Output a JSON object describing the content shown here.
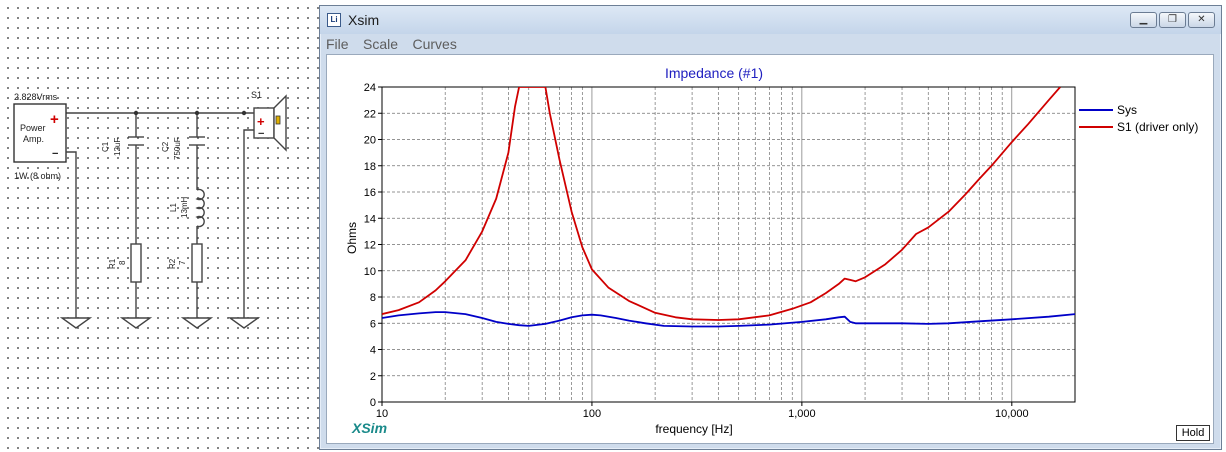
{
  "schematic": {
    "source_voltage": "2.828Vrms",
    "source_label_line1": "Power",
    "source_label_line2": "Amp.",
    "source_rating": "1W (8 ohm)",
    "plus": "+",
    "minus": "−",
    "c1_name": "C1",
    "c1_value": "12uF",
    "c2_name": "C2",
    "c2_value": "750uF",
    "l1_name": "L1",
    "l1_value": "13mH",
    "r1_name": "R1",
    "r1_value": "8",
    "r2_name": "R2",
    "r2_value": "7",
    "speaker_name": "S1"
  },
  "window": {
    "title": "Xsim",
    "icon_text": "Li",
    "menu": [
      "File",
      "Scale",
      "Curves"
    ],
    "brand": "XSim",
    "hold_label": "Hold"
  },
  "chart_data": {
    "type": "line",
    "title": "Impedance (#1)",
    "xlabel": "frequency [Hz]",
    "ylabel": "Ohms",
    "x_scale": "log",
    "xlim": [
      10,
      20000
    ],
    "ylim": [
      0,
      24
    ],
    "x_ticks": [
      10,
      100,
      1000,
      10000
    ],
    "x_tick_labels": [
      "10",
      "100",
      "1,000",
      "10,000"
    ],
    "y_ticks": [
      0,
      2,
      4,
      6,
      8,
      10,
      12,
      14,
      16,
      18,
      20,
      22,
      24
    ],
    "grid": true,
    "legend_position": "right",
    "series": [
      {
        "name": "Sys",
        "color": "#0000c8",
        "points": [
          [
            10,
            6.4
          ],
          [
            12,
            6.6
          ],
          [
            15,
            6.75
          ],
          [
            18,
            6.85
          ],
          [
            20,
            6.85
          ],
          [
            25,
            6.7
          ],
          [
            30,
            6.4
          ],
          [
            35,
            6.1
          ],
          [
            40,
            5.95
          ],
          [
            45,
            5.85
          ],
          [
            50,
            5.8
          ],
          [
            60,
            5.95
          ],
          [
            70,
            6.2
          ],
          [
            80,
            6.45
          ],
          [
            90,
            6.6
          ],
          [
            100,
            6.65
          ],
          [
            110,
            6.6
          ],
          [
            130,
            6.4
          ],
          [
            150,
            6.2
          ],
          [
            180,
            6.0
          ],
          [
            220,
            5.8
          ],
          [
            300,
            5.75
          ],
          [
            400,
            5.75
          ],
          [
            500,
            5.8
          ],
          [
            700,
            5.9
          ],
          [
            1000,
            6.1
          ],
          [
            1300,
            6.3
          ],
          [
            1500,
            6.45
          ],
          [
            1600,
            6.5
          ],
          [
            1700,
            6.1
          ],
          [
            1800,
            6.0
          ],
          [
            2000,
            6.0
          ],
          [
            3000,
            6.0
          ],
          [
            4000,
            5.95
          ],
          [
            5000,
            6.0
          ],
          [
            7000,
            6.15
          ],
          [
            10000,
            6.3
          ],
          [
            15000,
            6.5
          ],
          [
            20000,
            6.7
          ]
        ]
      },
      {
        "name": "S1 (driver only)",
        "color": "#d00000",
        "points": [
          [
            10,
            6.7
          ],
          [
            12,
            7.0
          ],
          [
            15,
            7.6
          ],
          [
            18,
            8.5
          ],
          [
            20,
            9.2
          ],
          [
            25,
            10.8
          ],
          [
            30,
            13.0
          ],
          [
            35,
            15.5
          ],
          [
            40,
            19.0
          ],
          [
            43,
            22.5
          ],
          [
            45,
            24.0
          ],
          [
            60,
            24.0
          ],
          [
            63,
            22.0
          ],
          [
            70,
            18.5
          ],
          [
            80,
            14.5
          ],
          [
            90,
            11.8
          ],
          [
            100,
            10.1
          ],
          [
            120,
            8.7
          ],
          [
            150,
            7.7
          ],
          [
            200,
            6.8
          ],
          [
            250,
            6.45
          ],
          [
            300,
            6.3
          ],
          [
            400,
            6.25
          ],
          [
            500,
            6.3
          ],
          [
            700,
            6.6
          ],
          [
            900,
            7.1
          ],
          [
            1100,
            7.6
          ],
          [
            1300,
            8.3
          ],
          [
            1500,
            9.0
          ],
          [
            1600,
            9.4
          ],
          [
            1700,
            9.3
          ],
          [
            1800,
            9.2
          ],
          [
            2000,
            9.5
          ],
          [
            2500,
            10.5
          ],
          [
            3000,
            11.6
          ],
          [
            3500,
            12.8
          ],
          [
            4000,
            13.3
          ],
          [
            5000,
            14.5
          ],
          [
            6000,
            15.8
          ],
          [
            7000,
            17.0
          ],
          [
            8000,
            18.0
          ],
          [
            10000,
            19.8
          ],
          [
            12000,
            21.2
          ],
          [
            15000,
            23.0
          ],
          [
            17000,
            24.0
          ]
        ]
      }
    ]
  }
}
